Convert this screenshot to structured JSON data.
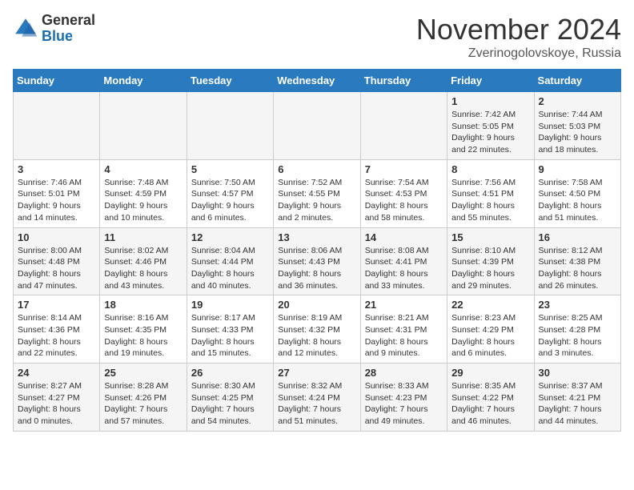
{
  "logo": {
    "general": "General",
    "blue": "Blue"
  },
  "title": "November 2024",
  "location": "Zverinogolovskoye, Russia",
  "days_of_week": [
    "Sunday",
    "Monday",
    "Tuesday",
    "Wednesday",
    "Thursday",
    "Friday",
    "Saturday"
  ],
  "weeks": [
    [
      {
        "day": "",
        "info": ""
      },
      {
        "day": "",
        "info": ""
      },
      {
        "day": "",
        "info": ""
      },
      {
        "day": "",
        "info": ""
      },
      {
        "day": "",
        "info": ""
      },
      {
        "day": "1",
        "info": "Sunrise: 7:42 AM\nSunset: 5:05 PM\nDaylight: 9 hours and 22 minutes."
      },
      {
        "day": "2",
        "info": "Sunrise: 7:44 AM\nSunset: 5:03 PM\nDaylight: 9 hours and 18 minutes."
      }
    ],
    [
      {
        "day": "3",
        "info": "Sunrise: 7:46 AM\nSunset: 5:01 PM\nDaylight: 9 hours and 14 minutes."
      },
      {
        "day": "4",
        "info": "Sunrise: 7:48 AM\nSunset: 4:59 PM\nDaylight: 9 hours and 10 minutes."
      },
      {
        "day": "5",
        "info": "Sunrise: 7:50 AM\nSunset: 4:57 PM\nDaylight: 9 hours and 6 minutes."
      },
      {
        "day": "6",
        "info": "Sunrise: 7:52 AM\nSunset: 4:55 PM\nDaylight: 9 hours and 2 minutes."
      },
      {
        "day": "7",
        "info": "Sunrise: 7:54 AM\nSunset: 4:53 PM\nDaylight: 8 hours and 58 minutes."
      },
      {
        "day": "8",
        "info": "Sunrise: 7:56 AM\nSunset: 4:51 PM\nDaylight: 8 hours and 55 minutes."
      },
      {
        "day": "9",
        "info": "Sunrise: 7:58 AM\nSunset: 4:50 PM\nDaylight: 8 hours and 51 minutes."
      }
    ],
    [
      {
        "day": "10",
        "info": "Sunrise: 8:00 AM\nSunset: 4:48 PM\nDaylight: 8 hours and 47 minutes."
      },
      {
        "day": "11",
        "info": "Sunrise: 8:02 AM\nSunset: 4:46 PM\nDaylight: 8 hours and 43 minutes."
      },
      {
        "day": "12",
        "info": "Sunrise: 8:04 AM\nSunset: 4:44 PM\nDaylight: 8 hours and 40 minutes."
      },
      {
        "day": "13",
        "info": "Sunrise: 8:06 AM\nSunset: 4:43 PM\nDaylight: 8 hours and 36 minutes."
      },
      {
        "day": "14",
        "info": "Sunrise: 8:08 AM\nSunset: 4:41 PM\nDaylight: 8 hours and 33 minutes."
      },
      {
        "day": "15",
        "info": "Sunrise: 8:10 AM\nSunset: 4:39 PM\nDaylight: 8 hours and 29 minutes."
      },
      {
        "day": "16",
        "info": "Sunrise: 8:12 AM\nSunset: 4:38 PM\nDaylight: 8 hours and 26 minutes."
      }
    ],
    [
      {
        "day": "17",
        "info": "Sunrise: 8:14 AM\nSunset: 4:36 PM\nDaylight: 8 hours and 22 minutes."
      },
      {
        "day": "18",
        "info": "Sunrise: 8:16 AM\nSunset: 4:35 PM\nDaylight: 8 hours and 19 minutes."
      },
      {
        "day": "19",
        "info": "Sunrise: 8:17 AM\nSunset: 4:33 PM\nDaylight: 8 hours and 15 minutes."
      },
      {
        "day": "20",
        "info": "Sunrise: 8:19 AM\nSunset: 4:32 PM\nDaylight: 8 hours and 12 minutes."
      },
      {
        "day": "21",
        "info": "Sunrise: 8:21 AM\nSunset: 4:31 PM\nDaylight: 8 hours and 9 minutes."
      },
      {
        "day": "22",
        "info": "Sunrise: 8:23 AM\nSunset: 4:29 PM\nDaylight: 8 hours and 6 minutes."
      },
      {
        "day": "23",
        "info": "Sunrise: 8:25 AM\nSunset: 4:28 PM\nDaylight: 8 hours and 3 minutes."
      }
    ],
    [
      {
        "day": "24",
        "info": "Sunrise: 8:27 AM\nSunset: 4:27 PM\nDaylight: 8 hours and 0 minutes."
      },
      {
        "day": "25",
        "info": "Sunrise: 8:28 AM\nSunset: 4:26 PM\nDaylight: 7 hours and 57 minutes."
      },
      {
        "day": "26",
        "info": "Sunrise: 8:30 AM\nSunset: 4:25 PM\nDaylight: 7 hours and 54 minutes."
      },
      {
        "day": "27",
        "info": "Sunrise: 8:32 AM\nSunset: 4:24 PM\nDaylight: 7 hours and 51 minutes."
      },
      {
        "day": "28",
        "info": "Sunrise: 8:33 AM\nSunset: 4:23 PM\nDaylight: 7 hours and 49 minutes."
      },
      {
        "day": "29",
        "info": "Sunrise: 8:35 AM\nSunset: 4:22 PM\nDaylight: 7 hours and 46 minutes."
      },
      {
        "day": "30",
        "info": "Sunrise: 8:37 AM\nSunset: 4:21 PM\nDaylight: 7 hours and 44 minutes."
      }
    ]
  ]
}
